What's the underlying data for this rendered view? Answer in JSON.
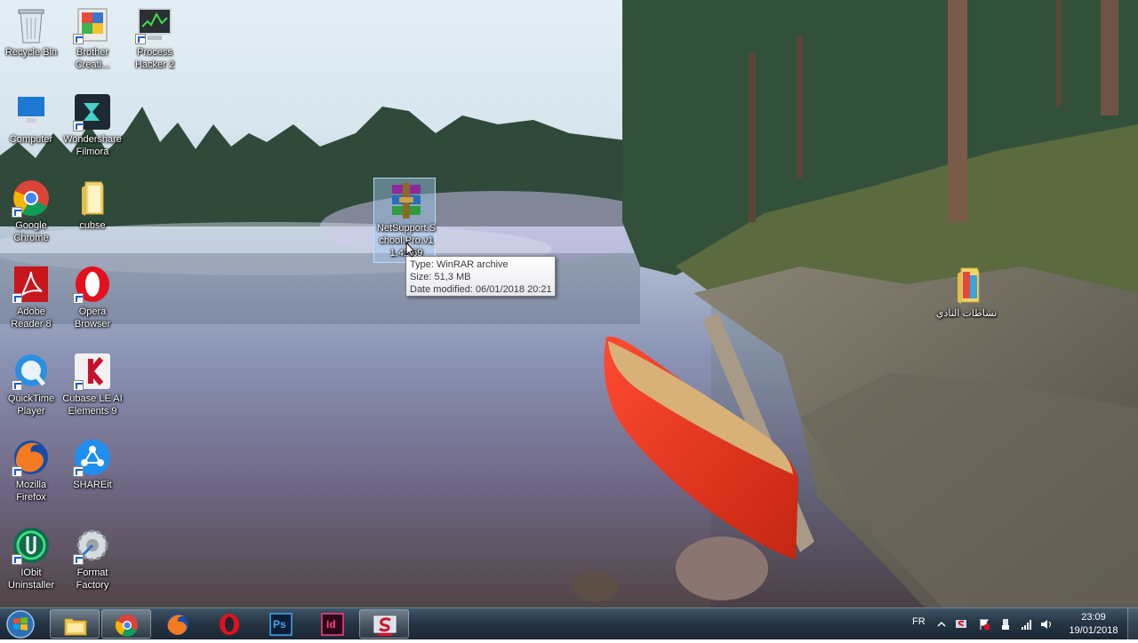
{
  "desktop": {
    "icons": [
      {
        "label": "Recycle Bin"
      },
      {
        "label": "Brother Creati..."
      },
      {
        "label": "Process Hacker 2"
      },
      {
        "label": "Computer"
      },
      {
        "label": "Wondershare Filmora"
      },
      {
        "label": "Google Chrome"
      },
      {
        "label": "cubse"
      },
      {
        "label": "Adobe Reader 8"
      },
      {
        "label": "Opera Browser"
      },
      {
        "label": "QuickTime Player"
      },
      {
        "label": "Cubase LE AI Elements 9"
      },
      {
        "label": "Mozilla Firefox"
      },
      {
        "label": "SHAREit"
      },
      {
        "label": "IObit Uninstaller"
      },
      {
        "label": "Format Factory"
      },
      {
        "label": "NetSupport.School.Pro.v1 1.41.69"
      },
      {
        "label": "نشاطات النادي"
      }
    ],
    "tooltip": {
      "type": "Type: WinRAR archive",
      "size": "Size: 51,3 MB",
      "modified": "Date modified: 06/01/2018 20:21"
    }
  },
  "taskbar": {
    "apps": [
      {
        "name": "windows-explorer"
      },
      {
        "name": "google-chrome"
      },
      {
        "name": "firefox"
      },
      {
        "name": "opera"
      },
      {
        "name": "photoshop",
        "text": "Ps"
      },
      {
        "name": "indesign",
        "text": "Id"
      },
      {
        "name": "netsupport-school"
      }
    ],
    "language": "FR",
    "time": "23:09",
    "date": "19/01/2018"
  }
}
